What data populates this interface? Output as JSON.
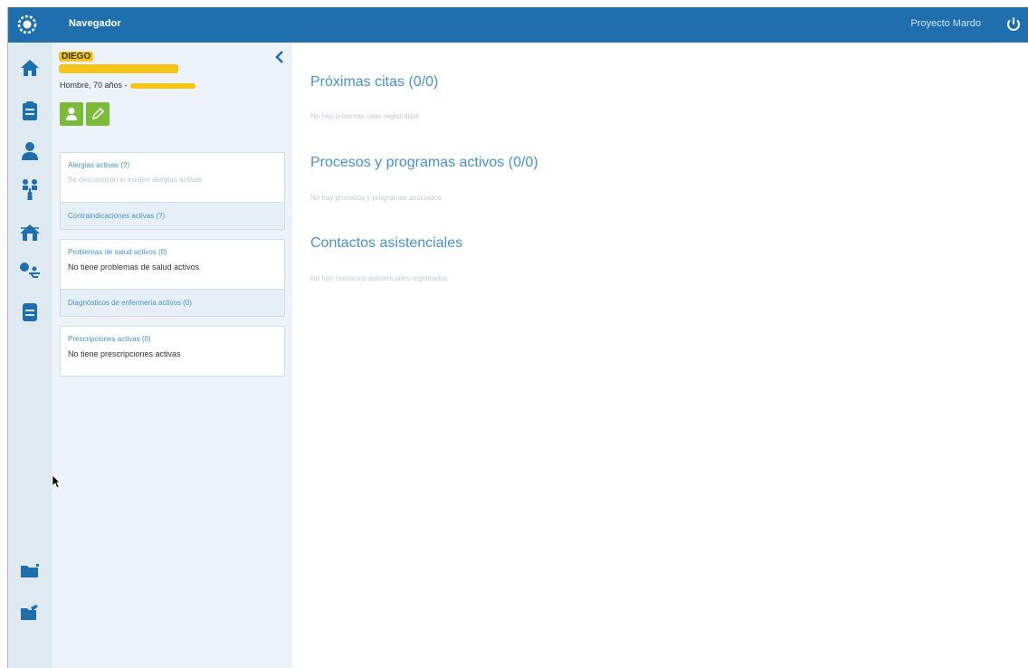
{
  "topbar": {
    "title": "Navegador",
    "project": "Proyecto Mardo"
  },
  "patient": {
    "name": "DIEGO",
    "demographics": "Hombre, 70 años -"
  },
  "cards": {
    "allergies": {
      "title": "Alergias activas (?)",
      "text": "Se desconocen si existen alergias activas",
      "sub": "Contraindicaciones activas (?)"
    },
    "problems": {
      "title": "Problemas de salud activos (0)",
      "text": "No tiene problemas de salud activos",
      "sub": "Diagnósticos de enfermería activos (0)"
    },
    "prescriptions": {
      "title": "Prescripciones activas (0)",
      "text": "No tiene prescripciones activas"
    }
  },
  "main": {
    "appointments": {
      "title": "Próximas citas (0/0)",
      "empty": "No hay próximas citas registradas"
    },
    "processes": {
      "title": "Procesos y programas activos (0/0)",
      "empty": "No hay procesos y programas asociados"
    },
    "contacts": {
      "title": "Contactos asistenciales",
      "empty": "No hay contactos asistenciales registrados"
    }
  },
  "colors": {
    "topbar": "#1f6fae",
    "accent": "#4a90c8",
    "green": "#7cba3c",
    "iconbar": "#dfe9f1",
    "panel": "#ecf2f7"
  },
  "icons": [
    "gear-logo-icon",
    "power-icon",
    "home-icon",
    "clipboard-icon",
    "person-icon",
    "family-icon",
    "house-network-icon",
    "care-icon",
    "document-icon",
    "folder-icon",
    "edit-folder-icon",
    "chevron-left-icon"
  ]
}
